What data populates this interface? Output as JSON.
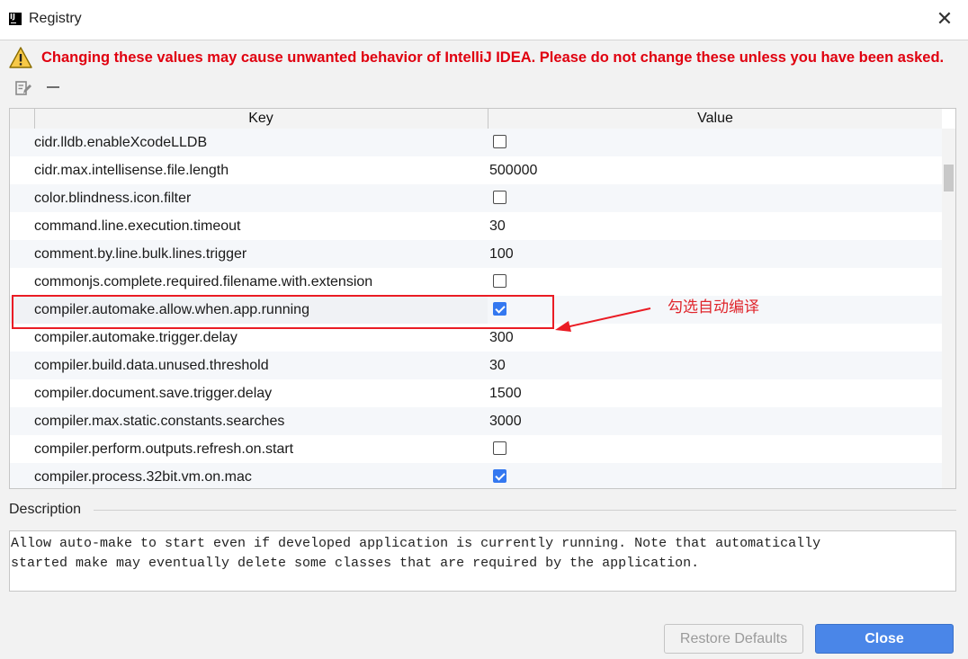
{
  "window": {
    "title": "Registry",
    "close_glyph": "✕",
    "app_icon_text": "IJ"
  },
  "warning": {
    "text": "Changing these values may cause unwanted behavior of IntelliJ IDEA. Please do not change these unless you have been asked.",
    "color": "#e0000f"
  },
  "table": {
    "headers": {
      "key": "Key",
      "value": "Value"
    },
    "rows": [
      {
        "key": "cidr.lldb.enableXcodeLLDB",
        "type": "checkbox",
        "checked": false
      },
      {
        "key": "cidr.max.intellisense.file.length",
        "type": "text",
        "value": "500000"
      },
      {
        "key": "color.blindness.icon.filter",
        "type": "checkbox",
        "checked": false
      },
      {
        "key": "command.line.execution.timeout",
        "type": "text",
        "value": "30"
      },
      {
        "key": "comment.by.line.bulk.lines.trigger",
        "type": "text",
        "value": "100"
      },
      {
        "key": "commonjs.complete.required.filename.with.extension",
        "type": "checkbox",
        "checked": false
      },
      {
        "key": "compiler.automake.allow.when.app.running",
        "type": "checkbox",
        "checked": true,
        "selected": true
      },
      {
        "key": "compiler.automake.trigger.delay",
        "type": "text",
        "value": "300"
      },
      {
        "key": "compiler.build.data.unused.threshold",
        "type": "text",
        "value": "30"
      },
      {
        "key": "compiler.document.save.trigger.delay",
        "type": "text",
        "value": "1500"
      },
      {
        "key": "compiler.max.static.constants.searches",
        "type": "text",
        "value": "3000"
      },
      {
        "key": "compiler.perform.outputs.refresh.on.start",
        "type": "checkbox",
        "checked": false
      },
      {
        "key": "compiler.process.32bit.vm.on.mac",
        "type": "checkbox",
        "checked": true
      }
    ]
  },
  "annotation": {
    "text": "勾选自动编译",
    "color": "#e0262c"
  },
  "description": {
    "label": "Description",
    "text": "Allow auto-make to start even if developed application is currently running. Note that automatically\nstarted make may eventually delete some classes that are required by the application."
  },
  "buttons": {
    "restore_defaults": "Restore Defaults",
    "close": "Close"
  },
  "colors": {
    "accent": "#4a86e8",
    "checkbox_checked": "#3478f0",
    "highlight": "#ea1c24"
  }
}
